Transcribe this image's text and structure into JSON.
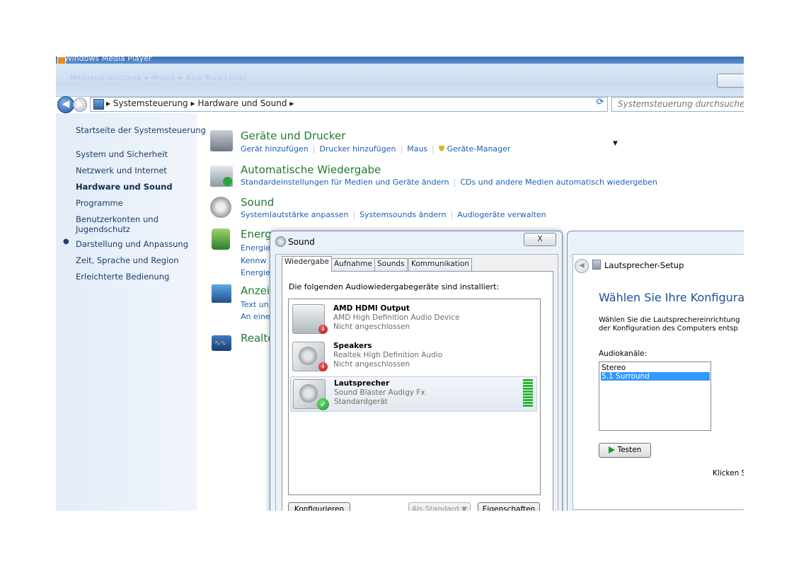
{
  "window": {
    "wmp_title": "Windows Media Player",
    "blurred_nav": "Medienbibliothek ▸ Musik ▸ Alle Musiktitel"
  },
  "address": {
    "path": "▸ Systemsteuerung ▸ Hardware und Sound ▸",
    "search_placeholder": "Systemsteuerung durchsuchen"
  },
  "sidebar": {
    "home": "Startseite der Systemsteuerung",
    "items": [
      {
        "label": "System und Sicherheit"
      },
      {
        "label": "Netzwerk und Internet"
      },
      {
        "label": "Hardware und Sound",
        "active": true
      },
      {
        "label": "Programme"
      },
      {
        "label": "Benutzerkonten und"
      },
      {
        "label": "Jugendschutz"
      },
      {
        "label": "Darstellung und Anpassung"
      },
      {
        "label": "Zeit, Sprache und Region"
      },
      {
        "label": "Erleichterte Bedienung"
      }
    ]
  },
  "categories": [
    {
      "title": "Geräte und Drucker",
      "links": [
        "Gerät hinzufügen",
        "Drucker hinzufügen",
        "Maus",
        "Geräte-Manager"
      ]
    },
    {
      "title": "Automatische Wiedergabe",
      "links": [
        "Standardeinstellungen für Medien und Geräte ändern",
        "CDs und andere Medien automatisch wiedergeben"
      ]
    },
    {
      "title": "Sound",
      "links": [
        "Systemlautstärke anpassen",
        "Systemsounds ändern",
        "Audiogeräte verwalten"
      ]
    },
    {
      "title": "Energ",
      "links": [
        "Energie",
        "Kennw",
        "Energie"
      ]
    },
    {
      "title": "Anzei",
      "links": [
        "Text un",
        "An eine"
      ]
    },
    {
      "title": "Realte",
      "links": []
    }
  ],
  "sound_dialog": {
    "title": "Sound",
    "close": "X",
    "tabs": [
      "Wiedergabe",
      "Aufnahme",
      "Sounds",
      "Kommunikation"
    ],
    "heading": "Die folgenden Audiowiedergabegeräte sind installiert:",
    "devices": [
      {
        "name": "AMD HDMI Output",
        "desc": "AMD High Definition Audio Device",
        "status": "Nicht angeschlossen"
      },
      {
        "name": "Speakers",
        "desc": "Realtek High Definition Audio",
        "status": "Nicht angeschlossen"
      },
      {
        "name": "Lautsprecher",
        "desc": "Sound Blaster Audigy Fx",
        "status": "Standardgerät"
      }
    ],
    "buttons": {
      "configure": "Konfigurieren",
      "set_default": "Als Standard",
      "properties": "Eigenschaften"
    }
  },
  "setup": {
    "title": "Lautsprecher-Setup",
    "heading": "Wählen Sie Ihre Konfiguratior",
    "desc1": "Wählen Sie die Lautsprechereinrichtung",
    "desc2": "der Konfiguration des Computers entsp",
    "channels_label": "Audiokanäle:",
    "channels": [
      "Stereo",
      "5.1 Surround"
    ],
    "selected_channel": "5.1 Surround",
    "test_button": "Testen",
    "click_text": "Klicken S"
  },
  "colors": {
    "accent": "#1a5fb4",
    "category_title": "#1e7b2e",
    "selection": "#3399ff"
  }
}
